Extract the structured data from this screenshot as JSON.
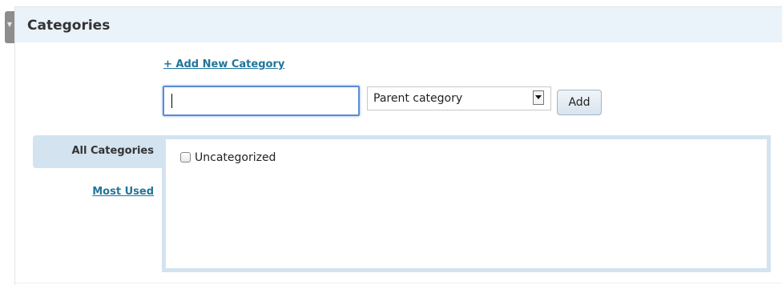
{
  "metabox": {
    "title": "Categories",
    "collapse_icon": "collapse-arrow-icon"
  },
  "add_category": {
    "link_label": "+ Add New Category",
    "input_value": "",
    "parent_select": {
      "selected": "Parent category"
    },
    "add_button_label": "Add"
  },
  "tabs": [
    {
      "label": "All Categories",
      "active": true
    },
    {
      "label": "Most Used",
      "active": false
    }
  ],
  "categories": [
    {
      "label": "Uncategorized",
      "checked": false
    }
  ],
  "colors": {
    "header_bg": "#eaf2fa",
    "tab_active_bg": "#d3e3f0",
    "link": "#21759b"
  }
}
